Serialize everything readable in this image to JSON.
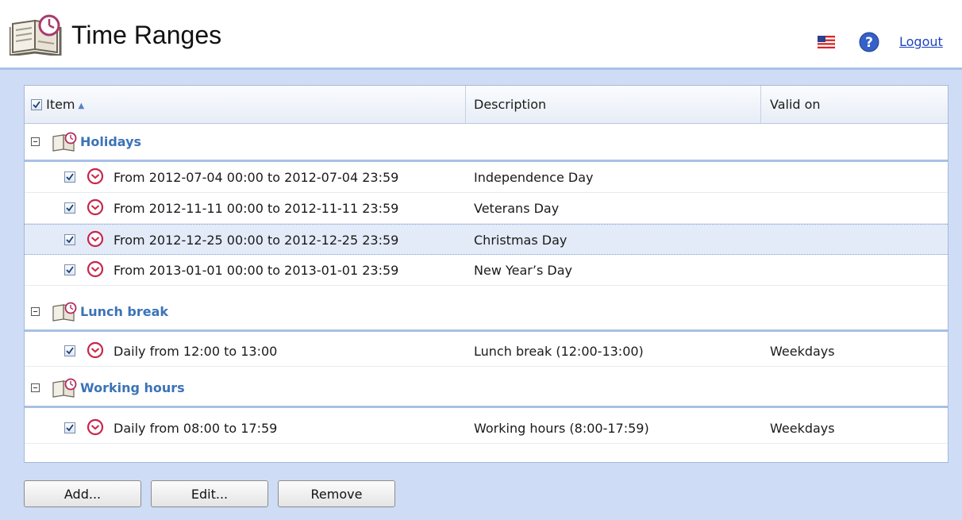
{
  "header": {
    "title": "Time Ranges",
    "logout_label": "Logout",
    "app_icon": "book-clock-icon",
    "language_icon": "us-flag-icon",
    "help_icon": "question-mark-icon"
  },
  "grid": {
    "columns": {
      "item": "Item",
      "description": "Description",
      "valid_on": "Valid on"
    },
    "sort_column": "item",
    "sort_direction": "ascending",
    "select_all_checked": true,
    "groups": [
      {
        "name": "Holidays",
        "expanded": true,
        "rows": [
          {
            "item": "From 2012-07-04 00:00 to 2012-07-04 23:59",
            "description": "Independence Day",
            "valid_on": "",
            "checked": true,
            "selected": false
          },
          {
            "item": "From 2012-11-11 00:00 to 2012-11-11 23:59",
            "description": "Veterans Day",
            "valid_on": "",
            "checked": true,
            "selected": false
          },
          {
            "item": "From 2012-12-25 00:00 to 2012-12-25 23:59",
            "description": "Christmas Day",
            "valid_on": "",
            "checked": true,
            "selected": true
          },
          {
            "item": "From 2013-01-01 00:00 to 2013-01-01 23:59",
            "description": "New Year’s Day",
            "valid_on": "",
            "checked": true,
            "selected": false
          }
        ]
      },
      {
        "name": "Lunch break",
        "expanded": true,
        "rows": [
          {
            "item": "Daily from 12:00 to 13:00",
            "description": "Lunch break (12:00-13:00)",
            "valid_on": "Weekdays",
            "checked": true,
            "selected": false
          }
        ]
      },
      {
        "name": "Working hours",
        "expanded": true,
        "rows": [
          {
            "item": "Daily from 08:00 to 17:59",
            "description": "Working hours (8:00-17:59)",
            "valid_on": "Weekdays",
            "checked": true,
            "selected": false
          }
        ]
      }
    ]
  },
  "buttons": {
    "add": "Add...",
    "edit": "Edit...",
    "remove": "Remove"
  },
  "colors": {
    "group_label": "#3b73b9",
    "clock_icon": "#c8264b",
    "page_background": "#cfdcf6",
    "link": "#1e44c4"
  }
}
